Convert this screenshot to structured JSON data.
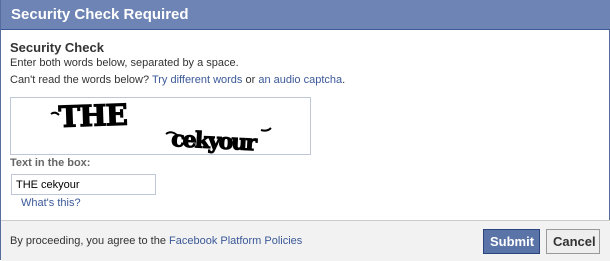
{
  "dialog": {
    "title": "Security Check Required"
  },
  "content": {
    "section_title": "Security Check",
    "instruction": "Enter both words below, separated by a space.",
    "cant_read_prefix": "Can't read the words below?",
    "try_different_link": "Try different words",
    "or_text": "or",
    "audio_link": "an audio captcha",
    "period": ".",
    "captcha_words": [
      "THE",
      "cekyour"
    ],
    "label_text_in_box": "Text in the box:",
    "input_value": "THE cekyour",
    "whats_this_link": "What's this?"
  },
  "footer": {
    "agree_prefix": "By proceeding, you agree to the",
    "policy_link": "Facebook Platform Policies",
    "submit_label": "Submit",
    "cancel_label": "Cancel"
  },
  "colors": {
    "title_bar": "#6d84b4",
    "link": "#3b5998",
    "submit_button": "#5b74a8"
  }
}
